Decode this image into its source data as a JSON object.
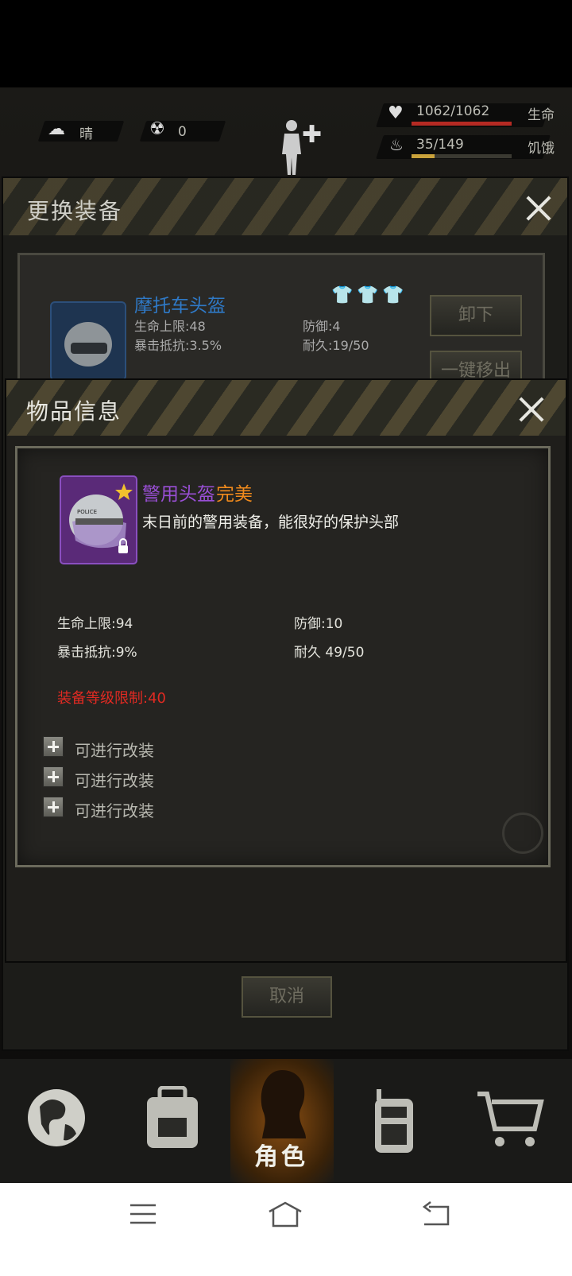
{
  "hud": {
    "weather": "晴",
    "radiation": "0",
    "hp": "1062/1062",
    "hp_label": "生命",
    "hunger": "35/149",
    "hunger_label": "饥饿"
  },
  "equip_panel": {
    "title": "更换装备",
    "item_name": "摩托车头盔",
    "stat_hp": "生命上限:48",
    "stat_crit": "暴击抵抗:3.5%",
    "stat_def": "防御:4",
    "stat_dur": "耐久:19/50",
    "unequip_label": "卸下",
    "remove_all_label": "一键移出",
    "cancel_label": "取消"
  },
  "item_info": {
    "title": "物品信息",
    "name": "警用头盔",
    "quality": "完美",
    "description": "末日前的警用装备，能很好的保护头部",
    "stat_hp": "生命上限:94",
    "stat_crit": "暴击抵抗:9%",
    "stat_def": "防御:10",
    "stat_dur": "耐久 49/50",
    "level_req": "装备等级限制:40",
    "mods": [
      "可进行改装",
      "可进行改装",
      "可进行改装"
    ],
    "helmet_tag": "POLICE"
  },
  "tabs": {
    "active_label": "角色"
  },
  "colors": {
    "item_name": "#9a4fd6",
    "quality": "#f08a1c",
    "level_req": "#e02a22",
    "equip_name": "#2f79c6"
  }
}
